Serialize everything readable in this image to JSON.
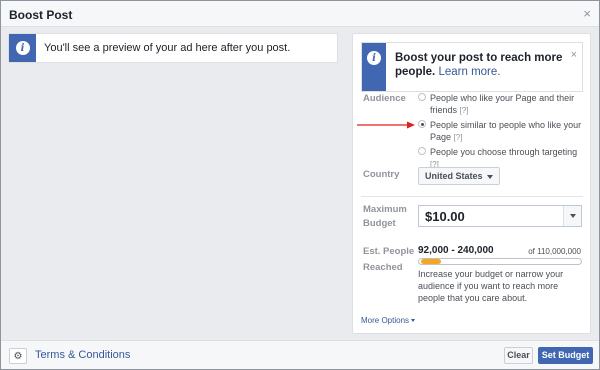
{
  "dialog": {
    "title": "Boost Post",
    "close_glyph": "×"
  },
  "preview": {
    "icon": "info-icon",
    "text": "You'll see a preview of your ad here after you post."
  },
  "tip": {
    "icon": "info-icon",
    "title": "Boost your post to reach more people.",
    "link": "Learn more.",
    "close_glyph": "×"
  },
  "audience": {
    "label": "Audience",
    "options": [
      {
        "text": "People who like your Page and their friends",
        "hint": "[?]",
        "selected": false
      },
      {
        "text": "People similar to people who like your Page",
        "hint": "[?]",
        "selected": true
      },
      {
        "text": "People you choose through targeting",
        "hint": "[?]",
        "selected": false
      }
    ]
  },
  "country": {
    "label": "Country",
    "value": "United States"
  },
  "budget": {
    "label": "Maximum Budget",
    "value": "$10.00"
  },
  "reach": {
    "label": "Est. People Reached",
    "range": "92,000 - 240,000",
    "total": "of 110,000,000",
    "bar_start_fraction": 0.0008,
    "bar_end_fraction": 0.0022,
    "description": "Increase your budget or narrow your audience if you want to reach more people that you care about."
  },
  "more_options": "More Options",
  "footer": {
    "terms": "Terms & Conditions",
    "clear": "Clear",
    "set_budget": "Set Budget",
    "gear_icon": "gear-icon"
  },
  "colors": {
    "accent": "#4267b2",
    "link": "#365899",
    "reach_fill": "#f5a623",
    "arrow": "#e02020"
  }
}
